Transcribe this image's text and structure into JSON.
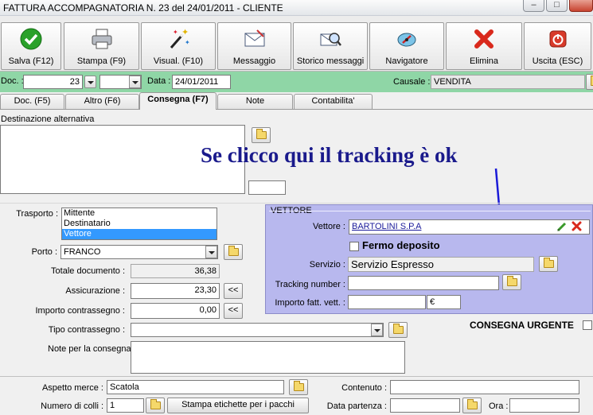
{
  "window": {
    "title": "FATTURA ACCOMPAGNATORIA N. 23  del 24/01/2011 - CLIENTE",
    "minimize": "–",
    "maximize": "□"
  },
  "toolbar": {
    "buttons": [
      {
        "label": "Salva (F12)",
        "icon": "check-icon"
      },
      {
        "label": "Stampa (F9)",
        "icon": "printer-icon"
      },
      {
        "label": "Visual. (F10)",
        "icon": "magic-wand-icon"
      },
      {
        "label": "Messaggio",
        "icon": "envelope-icon"
      },
      {
        "label": "Storico messaggi",
        "icon": "envelope-search-icon"
      },
      {
        "label": "Navigatore",
        "icon": "compass-icon"
      },
      {
        "label": "Elimina",
        "icon": "x-icon"
      },
      {
        "label": "Uscita (ESC)",
        "icon": "power-icon"
      }
    ]
  },
  "header": {
    "doc_label": "Doc. :",
    "doc_number": "23",
    "data_label": "Data :",
    "data_value": "24/01/2011",
    "causale_label": "Causale :",
    "causale_value": "VENDITA"
  },
  "tabs": [
    "Doc. (F5)",
    "Altro (F6)",
    "Consegna (F7)",
    "Note",
    "Contabilita'"
  ],
  "destinazione": {
    "legend": "Destinazione alternativa"
  },
  "annotation": {
    "text": "Se clicco qui il tracking è ok",
    "color": "#1a1a8c"
  },
  "form": {
    "trasporto_label": "Trasporto :",
    "trasporto_options": [
      "Mittente",
      "Destinatario",
      "Vettore"
    ],
    "trasporto_selected": "Vettore",
    "porto_label": "Porto :",
    "porto_value": "FRANCO",
    "totale_label": "Totale documento :",
    "totale_value": "36,38",
    "assicurazione_label": "Assicurazione :",
    "assicurazione_value": "23,30",
    "contrassegno_label": "Importo contrassegno :",
    "contrassegno_value": "0,00",
    "tipo_contrassegno_label": "Tipo contrassegno :",
    "note_label": "Note per la consegna",
    "back_label": "<<"
  },
  "vettore": {
    "legend": "VETTORE",
    "vettore_label": "Vettore :",
    "vettore_value": "BARTOLINI S.P.A",
    "fermo_label": "Fermo deposito",
    "servizio_label": "Servizio :",
    "servizio_value": "Servizio Espresso",
    "tracking_label": "Tracking number :",
    "importo_label": "Importo fatt. vett. :",
    "currency": "€",
    "bg_color": "#b8b8ee"
  },
  "urgente": {
    "label": "CONSEGNA URGENTE"
  },
  "bottom": {
    "aspetto_label": "Aspetto merce :",
    "aspetto_value": "Scatola",
    "colli_label": "Numero di colli :",
    "colli_value": "1",
    "stampa_label": "Stampa etichette per i pacchi",
    "contenuto_label": "Contenuto :",
    "partenza_label": "Data partenza :",
    "ora_label": "Ora :"
  },
  "colors": {
    "header_green": "#8fd6a6",
    "selection": "#3399ff"
  }
}
